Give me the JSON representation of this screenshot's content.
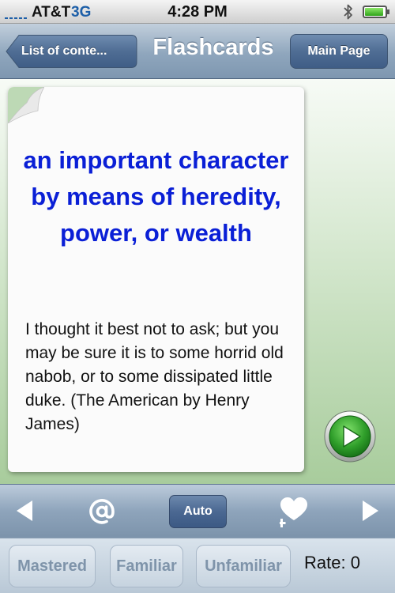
{
  "status_bar": {
    "carrier": "AT&T",
    "network": "3G",
    "time": "4:28 PM",
    "bluetooth_icon": "bluetooth-icon",
    "battery_icon": "battery-icon",
    "battery_level": 0.92
  },
  "nav": {
    "back_label": "List of conte...",
    "title": "Flashcards",
    "main_page_label": "Main Page"
  },
  "card": {
    "term": "an important character by means of heredity, power, or wealth",
    "example": "I thought it best not to ask; but you may be sure it is to some horrid old nabob, or to some dissipated little duke.  (The American by Henry James)",
    "play_icon": "play-icon",
    "term_color": "#0a1fd6"
  },
  "toolbar": {
    "prev_icon": "triangle-left-icon",
    "at_icon": "at-sign-icon",
    "auto_label": "Auto",
    "favorite_icon": "heart-plus-icon",
    "next_icon": "triangle-right-icon"
  },
  "rating": {
    "mastered": "Mastered",
    "familiar": "Familiar",
    "unfamiliar": "Unfamiliar",
    "rate_text": "Rate: 0"
  }
}
